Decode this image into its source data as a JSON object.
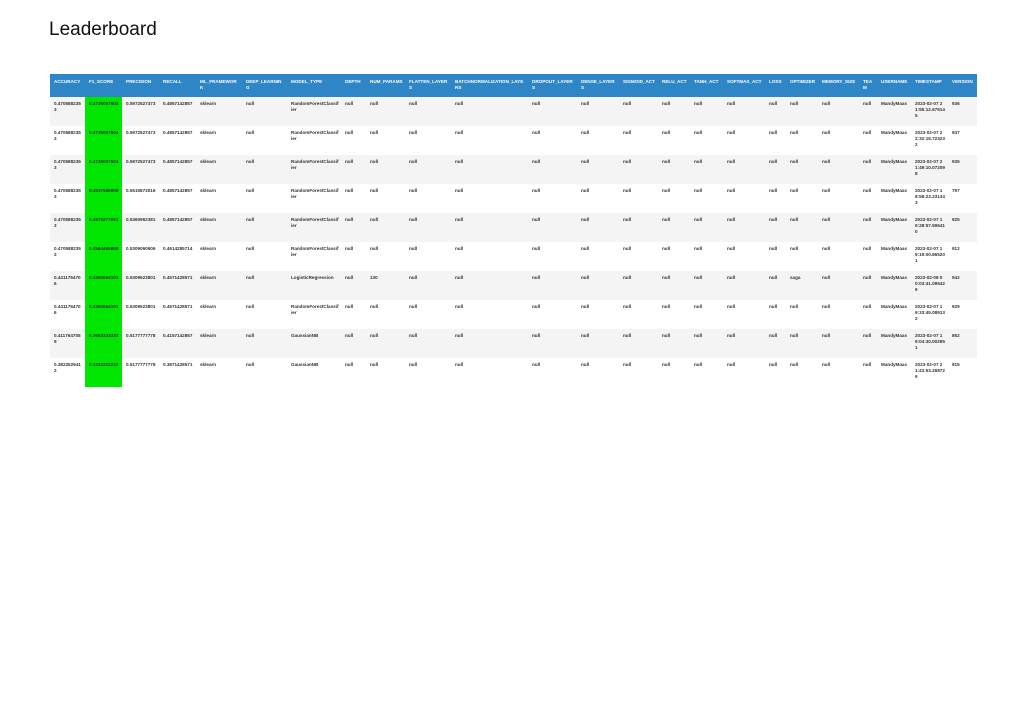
{
  "title": "Leaderboard",
  "highlight_color": "#00e600",
  "header_color": "#2f86c6",
  "columns": [
    "ACCURACY",
    "F1_SCORE",
    "PRECISION",
    "RECALL",
    "ML_FRAMEWORK",
    "DEEP_LEARNING",
    "MODEL_TYPE",
    "DEPTH",
    "NUM_PARAMS",
    "FLATTEN_LAYERS",
    "BATCHNORMALIZATION_LAYERS",
    "DROPOUT_LAYERS",
    "DENSE_LAYERS",
    "SIGMOID_ACT",
    "RELU_ACT",
    "TANH_ACT",
    "SOFTMAX_ACT",
    "LOSS",
    "OPTIMIZER",
    "MEMORY_SIZE",
    "TEAM",
    "USERNAME",
    "TIMESTAMP",
    "VERSION"
  ],
  "rows": [
    [
      "0.4705882353",
      "0.4735007504",
      "0.5972527473",
      "0.4857142857",
      "sklearn",
      "null",
      "RandomForestClassifier",
      "null",
      "null",
      "null",
      "null",
      "null",
      "null",
      "null",
      "null",
      "null",
      "null",
      "null",
      "null",
      "null",
      "null",
      "MandyMaas",
      "2023-02-07 21:55:12.679145",
      "936"
    ],
    [
      "0.4705882353",
      "0.4735007504",
      "0.5972527473",
      "0.4857142857",
      "sklearn",
      "null",
      "RandomForestClassifier",
      "null",
      "null",
      "null",
      "null",
      "null",
      "null",
      "null",
      "null",
      "null",
      "null",
      "null",
      "null",
      "null",
      "null",
      "MandyMaas",
      "2023-02-07 22:32:15.723232",
      "937"
    ],
    [
      "0.4705882353",
      "0.4735007504",
      "0.5972527473",
      "0.4857142857",
      "sklearn",
      "null",
      "RandomForestClassifier",
      "null",
      "null",
      "null",
      "null",
      "null",
      "null",
      "null",
      "null",
      "null",
      "null",
      "null",
      "null",
      "null",
      "null",
      "MandyMaas",
      "2023-02-07 21:49:10.072098",
      "935"
    ],
    [
      "0.4705882353",
      "0.4637559909",
      "0.5515873016",
      "0.4857142857",
      "sklearn",
      "null",
      "RandomForestClassifier",
      "null",
      "null",
      "null",
      "null",
      "null",
      "null",
      "null",
      "null",
      "null",
      "null",
      "null",
      "null",
      "null",
      "null",
      "MandyMaas",
      "2023-02-07 18:58:23.231343",
      "797"
    ],
    [
      "0.4705882353",
      "0.4670277091",
      "0.5360962381",
      "0.4857142857",
      "sklearn",
      "null",
      "RandomForestClassifier",
      "null",
      "null",
      "null",
      "null",
      "null",
      "null",
      "null",
      "null",
      "null",
      "null",
      "null",
      "null",
      "null",
      "null",
      "MandyMaas",
      "2023-02-07 19:28:57.596410",
      "925"
    ],
    [
      "0.4705882353",
      "0.4564465965",
      "0.5309060606",
      "0.4614285714",
      "sklearn",
      "null",
      "RandomForestClassifier",
      "null",
      "null",
      "null",
      "null",
      "null",
      "null",
      "null",
      "null",
      "null",
      "null",
      "null",
      "null",
      "null",
      "null",
      "MandyMaas",
      "2023-02-07 19:19:00.865201",
      "912"
    ],
    [
      "0.4411764706",
      "0.4350664101",
      "0.5309523801",
      "0.4571428571",
      "sklearn",
      "null",
      "LogisticRegression",
      "null",
      "130",
      "null",
      "null",
      "null",
      "null",
      "null",
      "null",
      "null",
      "null",
      "null",
      "saga",
      "null",
      "null",
      "MandyMaas",
      "2023-02-08 00:03:41.095429",
      "942"
    ],
    [
      "0.4411764706",
      "0.4350664101",
      "0.5309523801",
      "0.4571428571",
      "sklearn",
      "null",
      "RandomForestClassifier",
      "null",
      "null",
      "null",
      "null",
      "null",
      "null",
      "null",
      "null",
      "null",
      "null",
      "null",
      "null",
      "null",
      "null",
      "MandyMaas",
      "2023-02-07 19:33:45.089132",
      "929"
    ],
    [
      "0.4117647059",
      "0.3653333333",
      "0.5177777778",
      "0.4157142857",
      "sklearn",
      "null",
      "GaussianNB",
      "null",
      "null",
      "null",
      "null",
      "null",
      "null",
      "null",
      "null",
      "null",
      "null",
      "null",
      "null",
      "null",
      "null",
      "MandyMaas",
      "2023-02-07 19:04:30.002951",
      "852"
    ],
    [
      "0.3823529412",
      "0.3342222222",
      "0.5177777778",
      "0.3871428571",
      "sklearn",
      "null",
      "GaussianNB",
      "null",
      "null",
      "null",
      "null",
      "null",
      "null",
      "null",
      "null",
      "null",
      "null",
      "null",
      "null",
      "null",
      "null",
      "MandyMaas",
      "2023-02-07 21:43:53.268729",
      "915"
    ]
  ]
}
